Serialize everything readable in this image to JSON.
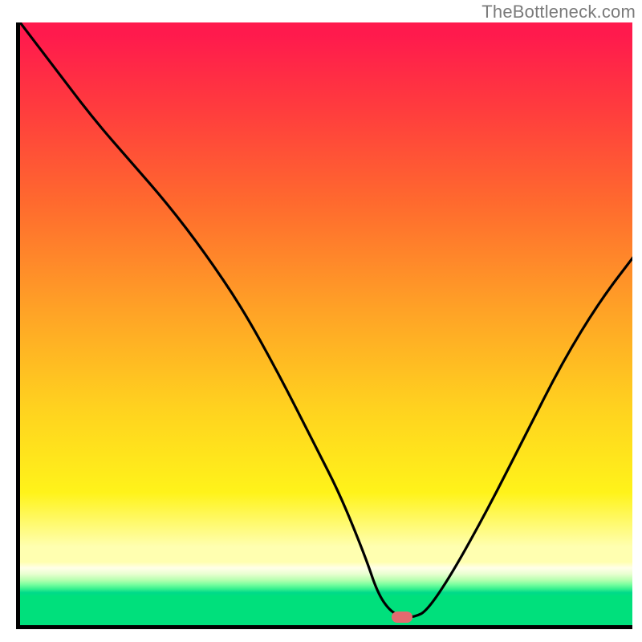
{
  "watermark": "TheBottleneck.com",
  "colors": {
    "axis": "#000000",
    "curve": "#000000",
    "marker": "#e46a6f",
    "gradient_stops": [
      {
        "pct": 0,
        "hex": "#ff1a4d"
      },
      {
        "pct": 14,
        "hex": "#ff3b3e"
      },
      {
        "pct": 30,
        "hex": "#ff6a2e"
      },
      {
        "pct": 48,
        "hex": "#ffa326"
      },
      {
        "pct": 64,
        "hex": "#ffd21f"
      },
      {
        "pct": 78,
        "hex": "#fff31a"
      },
      {
        "pct": 88,
        "hex": "#ffffb0"
      },
      {
        "pct": 91,
        "hex": "#ffffe8"
      },
      {
        "pct": 93,
        "hex": "#b7ffb0"
      },
      {
        "pct": 95,
        "hex": "#00e07c"
      }
    ]
  },
  "chart_data": {
    "type": "line",
    "title": "",
    "xlabel": "",
    "ylabel": "",
    "xlim": [
      0,
      100
    ],
    "ylim": [
      0,
      100
    ],
    "grid": false,
    "legend": false,
    "annotations": [
      "TheBottleneck.com"
    ],
    "marker": {
      "x": 62,
      "y": 2,
      "shape": "rounded-rect",
      "color": "#e46a6f"
    },
    "series": [
      {
        "name": "bottleneck-curve",
        "x": [
          0,
          6,
          12,
          18,
          24,
          30,
          36,
          42,
          48,
          52,
          56,
          58,
          60,
          62,
          64,
          66,
          70,
          76,
          82,
          88,
          94,
          100
        ],
        "y": [
          100,
          92,
          84,
          77,
          70,
          62,
          53,
          42,
          30,
          22,
          12,
          6,
          3,
          2,
          2,
          3,
          9,
          20,
          32,
          44,
          54,
          62
        ]
      }
    ]
  }
}
